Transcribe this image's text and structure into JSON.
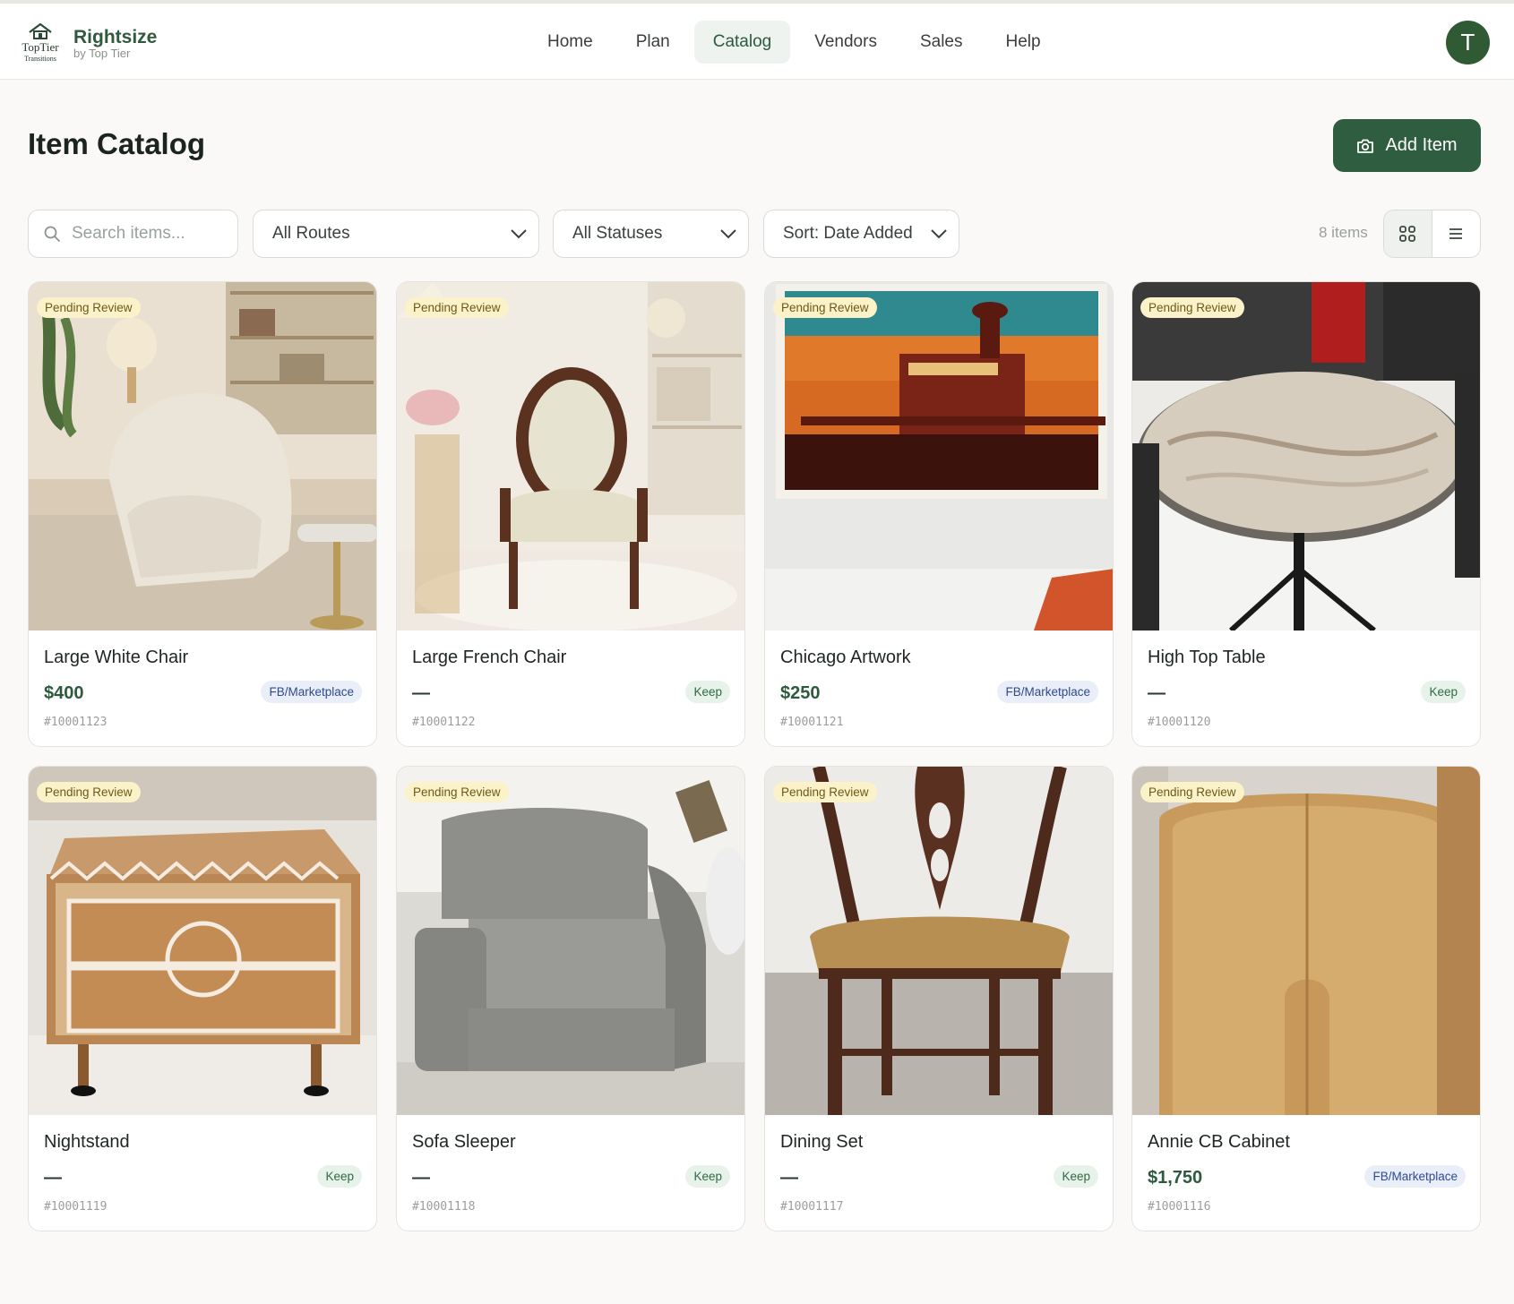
{
  "brand": {
    "logo_text": "TopTier",
    "logo_subtext": "Transitions",
    "name": "Rightsize",
    "tagline": "by Top Tier"
  },
  "nav": {
    "items": [
      {
        "label": "Home"
      },
      {
        "label": "Plan"
      },
      {
        "label": "Catalog",
        "active": true
      },
      {
        "label": "Vendors"
      },
      {
        "label": "Sales"
      },
      {
        "label": "Help"
      }
    ]
  },
  "user": {
    "initial": "T"
  },
  "page": {
    "title": "Item Catalog",
    "add_button_label": "Add Item"
  },
  "filters": {
    "search_placeholder": "Search items...",
    "route_select": "All Routes",
    "status_select": "All Statuses",
    "sort_select": "Sort: Date Added",
    "item_count": "8 items"
  },
  "items": [
    {
      "status": "Pending Review",
      "name": "Large White Chair",
      "price": "$400",
      "route": "FB/Marketplace",
      "sku": "#10001123"
    },
    {
      "status": "Pending Review",
      "name": "Large French Chair",
      "price": "—",
      "route": "Keep",
      "sku": "#10001122"
    },
    {
      "status": "Pending Review",
      "name": "Chicago Artwork",
      "price": "$250",
      "route": "FB/Marketplace",
      "sku": "#10001121"
    },
    {
      "status": "Pending Review",
      "name": "High Top Table",
      "price": "—",
      "route": "Keep",
      "sku": "#10001120"
    },
    {
      "status": "Pending Review",
      "name": "Nightstand",
      "price": "—",
      "route": "Keep",
      "sku": "#10001119"
    },
    {
      "status": "Pending Review",
      "name": "Sofa Sleeper",
      "price": "—",
      "route": "Keep",
      "sku": "#10001118"
    },
    {
      "status": "Pending Review",
      "name": "Dining Set",
      "price": "—",
      "route": "Keep",
      "sku": "#10001117"
    },
    {
      "status": "Pending Review",
      "name": "Annie CB Cabinet",
      "price": "$1,750",
      "route": "FB/Marketplace",
      "sku": "#10001116"
    }
  ],
  "colors": {
    "primary": "#2f5d3f",
    "pending_badge_bg": "#fbf2c9",
    "keep_badge_bg": "#e7f3ea",
    "marketplace_badge_bg": "#e9eef9"
  }
}
